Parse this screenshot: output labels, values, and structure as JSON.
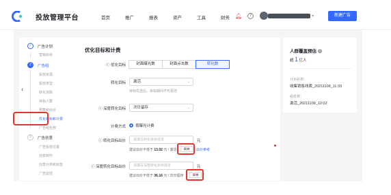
{
  "header": {
    "brand": "投放管理平台",
    "nav": [
      "首页",
      "推广",
      "报表",
      "资产",
      "工具",
      "财务"
    ],
    "create_button": "新建广告"
  },
  "steps": {
    "step1": {
      "num": "✓",
      "label": "广告计划"
    },
    "step1_subs": [
      "营销目标"
    ],
    "step2": {
      "num": "2",
      "label": "广告组"
    },
    "step2_subs": [
      "投放资源",
      "投放类型",
      "转化追踪",
      "目标人群",
      "预算和出价",
      "优化目标和计费",
      "广告组名称"
    ],
    "step3": {
      "num": "3",
      "label": "广告创意"
    },
    "step3_subs": [
      "广告投放位置",
      "创意制作",
      "创意分类和标签",
      "广告监控"
    ]
  },
  "form": {
    "title": "优化目标和计费",
    "opt_goal_label": "优化目标",
    "opt_goal_options": [
      "封面曝光数",
      "封面点击数",
      "转化数"
    ],
    "conv_target_label": "转化目标",
    "conv_target_value": "激活",
    "conv_target_hint": "目标优选后，目标期间不可更改",
    "deep_target_label": "深度转化目标",
    "deep_target_value": "次日留存",
    "billing_label": "计费方式",
    "billing_value": "按曝光计费",
    "bid_label": "转化目标出价",
    "bid_placeholder": "请填写转化目标成本",
    "bid_unit": "元",
    "bid_suggest_prefix": "建议出价不低于",
    "bid_suggest_value": "13.02",
    "bid_suggest_suffix": "元 / 激活",
    "bid_use": "采纳",
    "bid_link": "出价参考",
    "deep_bid_label": "深度转化目标出价",
    "deep_bid_placeholder": "请填写深度转化目标成本",
    "deep_bid_unit": "元",
    "deep_suggest_prefix": "建议出价不低于",
    "deep_suggest_value": "36.16",
    "deep_suggest_suffix": "元 / 次日留存",
    "deep_use": "采纳"
  },
  "side": {
    "title": "人群覆盖预估",
    "audience_prefix": "超",
    "audience_value": "1",
    "audience_unit": "亿人",
    "plan_key": "计划名称：",
    "plan_value": "收集销售线索_20211109_11:33",
    "group_key": "组名称：",
    "group_value": "激活_20211109_12:02"
  },
  "colors": {
    "accent": "#3369ff",
    "highlight": "#e5352b"
  }
}
